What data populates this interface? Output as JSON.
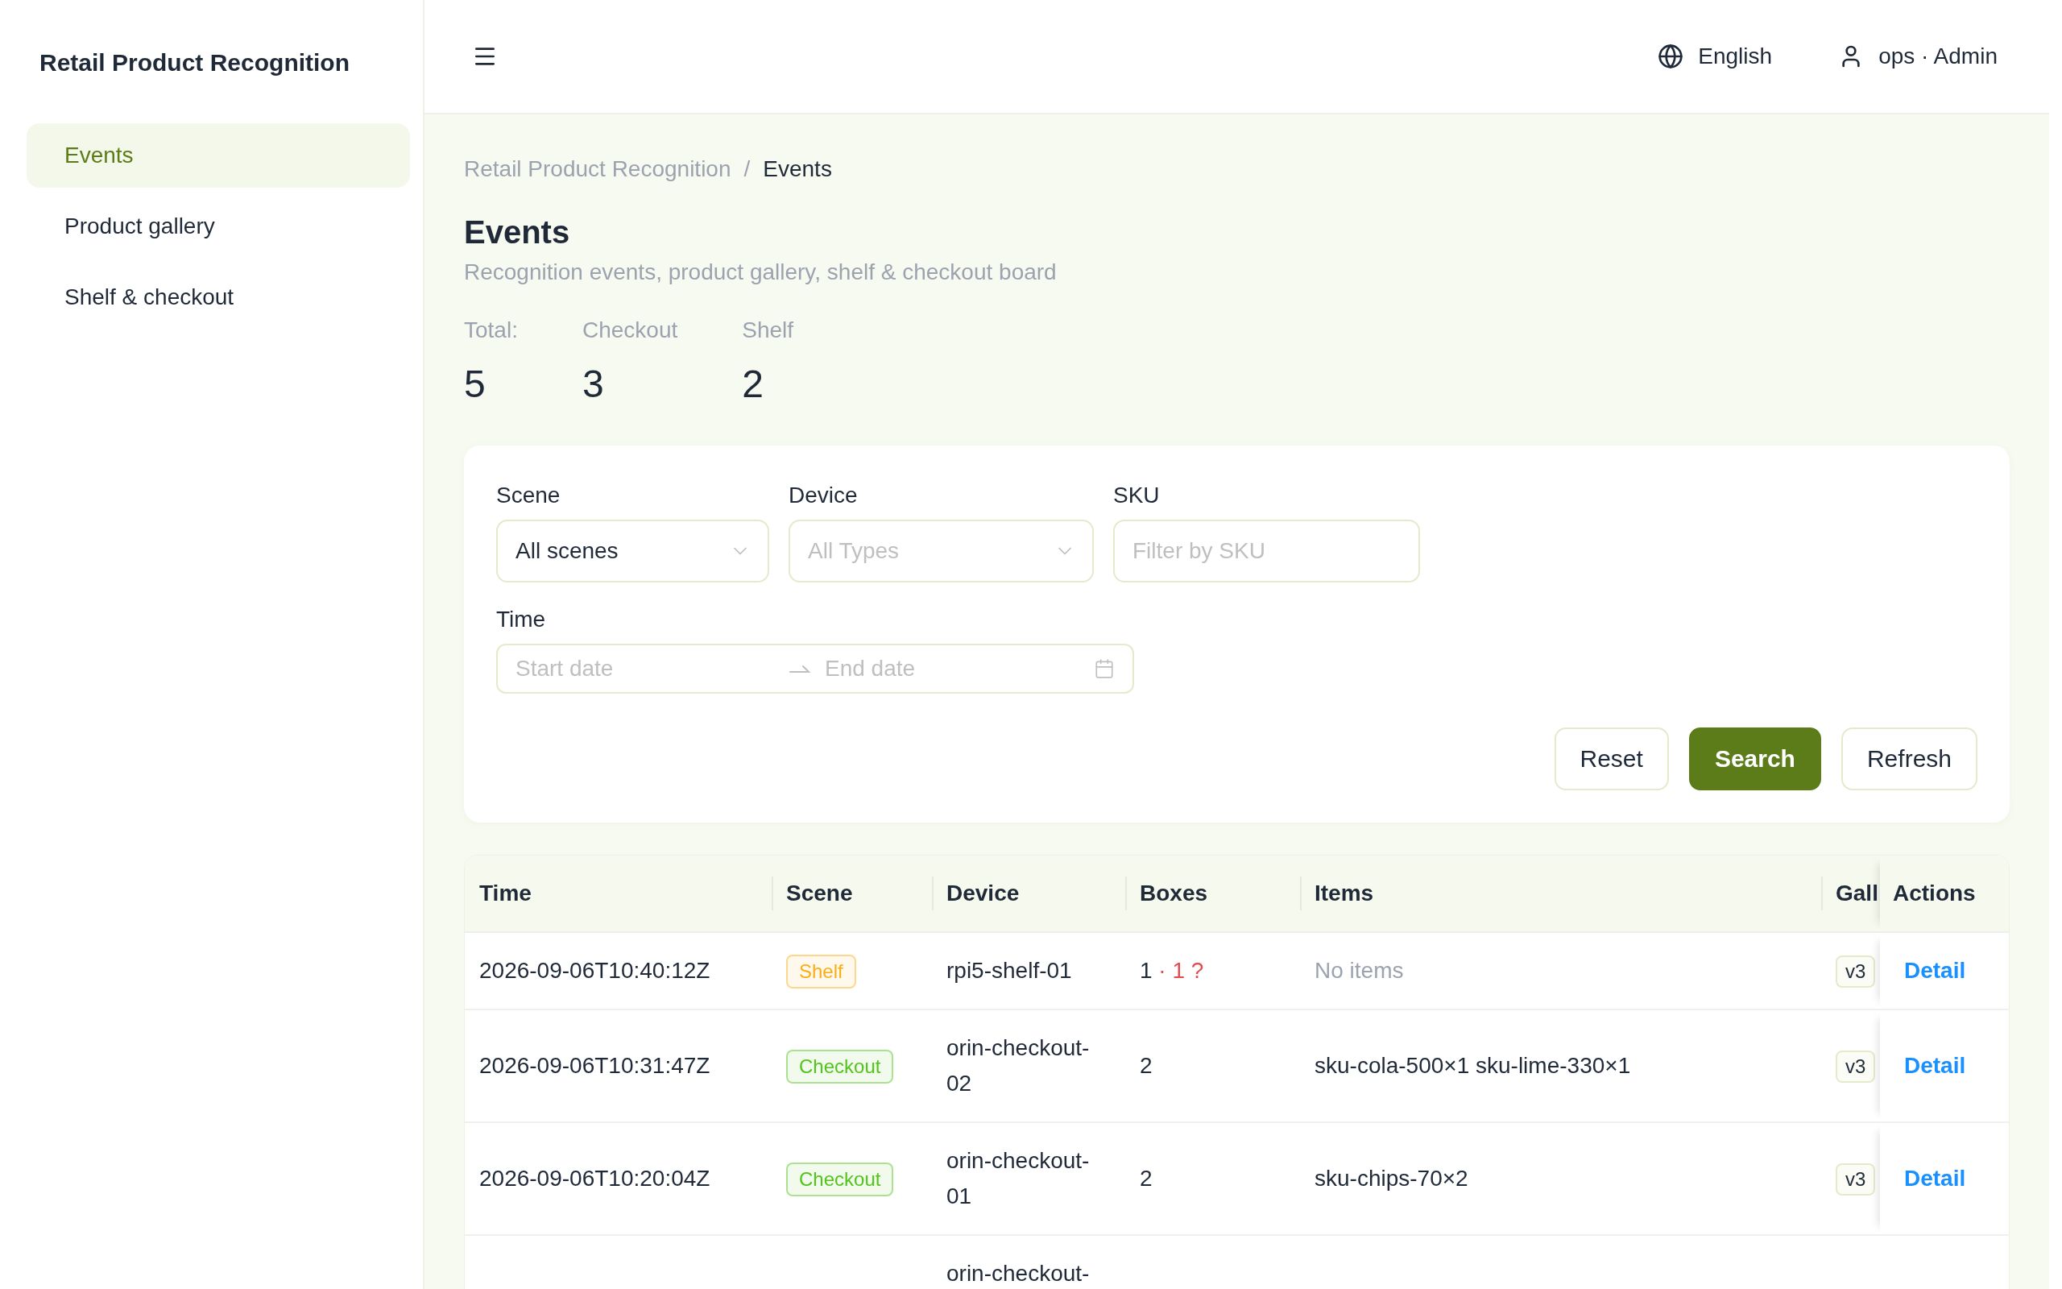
{
  "sidebar": {
    "title": "Retail Product Recognition",
    "items": [
      {
        "label": "Events",
        "selected": true
      },
      {
        "label": "Product gallery",
        "selected": false
      },
      {
        "label": "Shelf & checkout",
        "selected": false
      }
    ]
  },
  "header": {
    "language": "English",
    "user": "ops · Admin"
  },
  "breadcrumb": {
    "items": [
      {
        "label": "Retail Product Recognition",
        "current": false
      },
      {
        "label": "Events",
        "current": true
      }
    ],
    "separator": "/"
  },
  "page": {
    "title": "Events",
    "subtitle": "Recognition events, product gallery, shelf & checkout board"
  },
  "stats": [
    {
      "label": "Total:",
      "value": "5"
    },
    {
      "label": "Checkout",
      "value": "3"
    },
    {
      "label": "Shelf",
      "value": "2"
    }
  ],
  "filters": {
    "fields": [
      {
        "label": "Scene",
        "kind": "select",
        "value": "All scenes"
      },
      {
        "label": "Device",
        "kind": "select",
        "placeholder": "All Types"
      },
      {
        "label": "SKU",
        "kind": "input",
        "placeholder": "Filter by SKU"
      }
    ],
    "time": {
      "label": "Time",
      "start_placeholder": "Start date",
      "end_placeholder": "End date"
    },
    "buttons": [
      {
        "label": "Reset",
        "primary": false
      },
      {
        "label": "Search",
        "primary": true
      },
      {
        "label": "Refresh",
        "primary": false
      }
    ]
  },
  "table": {
    "columns": [
      "Time",
      "Scene",
      "Device",
      "Boxes",
      "Items",
      "Gall",
      "Actions"
    ],
    "rows": [
      {
        "time": "2026-09-06T10:40:12Z",
        "scene": {
          "label": "Shelf",
          "color": "#faad14"
        },
        "device": "rpi5-shelf-01",
        "boxes": "1",
        "unknown": "· 1 ?",
        "items": "No items",
        "no_items": true,
        "gallery": "v3",
        "action": "Detail"
      },
      {
        "time": "2026-09-06T10:31:47Z",
        "scene": {
          "label": "Checkout",
          "color": "#52c41a"
        },
        "device": "orin-checkout-02",
        "boxes": "2",
        "items": "sku-cola-500×1 sku-lime-330×1",
        "no_items": false,
        "gallery": "v3",
        "action": "Detail"
      },
      {
        "time": "2026-09-06T10:20:04Z",
        "scene": {
          "label": "Checkout",
          "color": "#52c41a"
        },
        "device": "orin-checkout-01",
        "boxes": "2",
        "items": "sku-chips-70×2",
        "no_items": false,
        "gallery": "v3",
        "action": "Detail"
      },
      {
        "device": "orin-checkout-"
      }
    ]
  }
}
